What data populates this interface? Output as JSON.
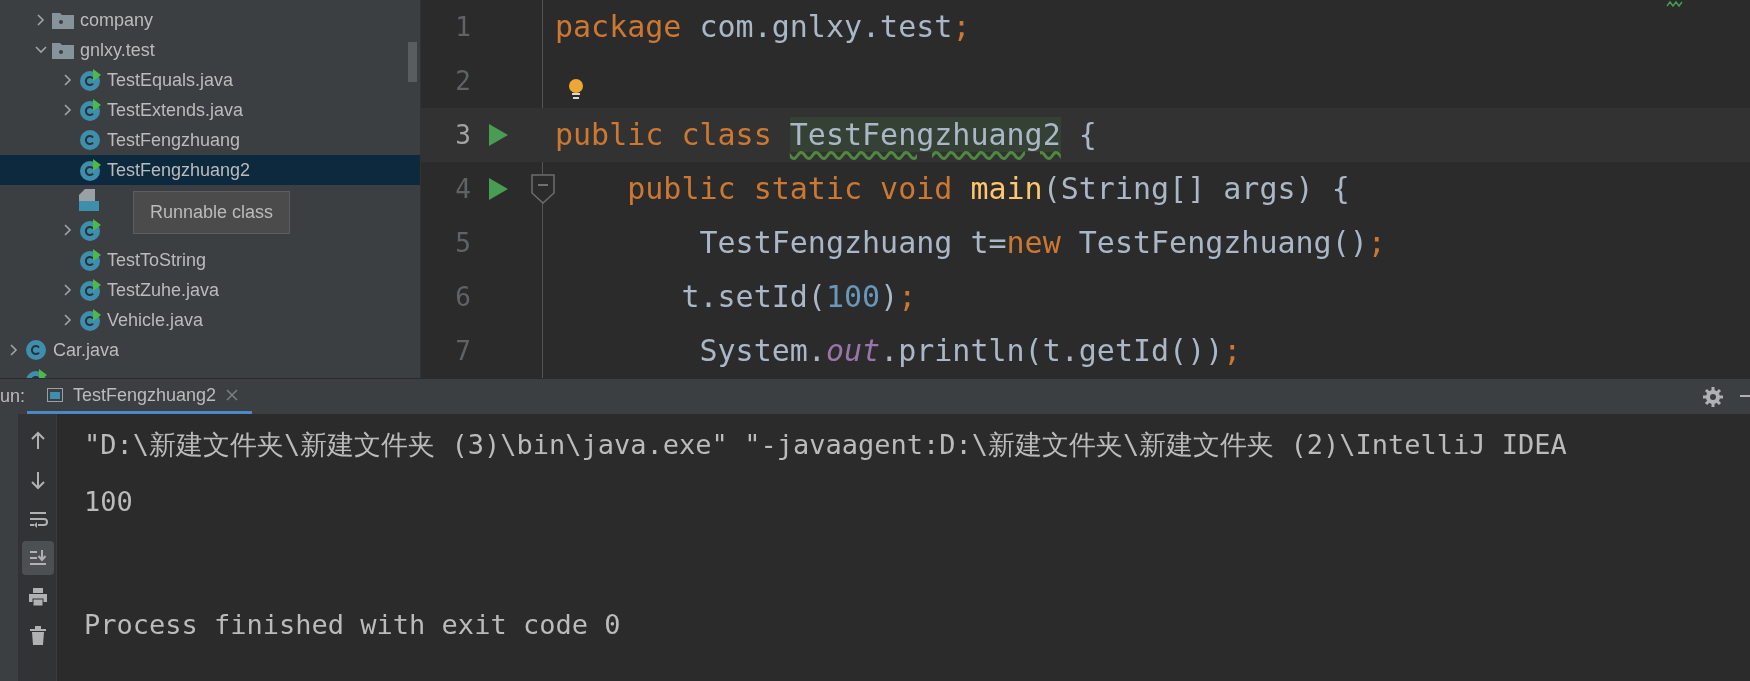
{
  "project_tree": {
    "items": [
      {
        "children": [
          {
            "label": "company",
            "kind": "folder",
            "expanded": false,
            "selected": false
          },
          {
            "label": "gnlxy.test",
            "kind": "folder",
            "expanded": true,
            "selected": false,
            "children": [
              {
                "label": "TestEquals.java",
                "kind": "runnable",
                "expanded": false,
                "selected": false
              },
              {
                "label": "TestExtends.java",
                "kind": "runnable",
                "expanded": false,
                "selected": false
              },
              {
                "label": "TestFengzhuang",
                "kind": "class",
                "selected": false
              },
              {
                "label": "TestFengzhuang2",
                "kind": "runnable",
                "selected": true
              },
              {
                "kind": "java-file",
                "selected": false
              },
              {
                "kind": "runnable",
                "expanded": false,
                "selected": false
              },
              {
                "label": "TestToString",
                "kind": "runnable",
                "selected": false
              },
              {
                "label": "TestZuhe.java",
                "kind": "runnable",
                "expanded": false,
                "selected": false
              },
              {
                "label": "Vehicle.java",
                "kind": "runnable",
                "expanded": false,
                "selected": false
              }
            ]
          }
        ]
      },
      {
        "label": "Car.java",
        "kind": "class",
        "expanded": false,
        "selected": false
      },
      {
        "kind": "runnable",
        "selected": false
      }
    ]
  },
  "tooltip": {
    "text": "Runnable class"
  },
  "editor": {
    "lines": [
      {
        "number": "1",
        "current": false,
        "run_marker": false,
        "fold_marker": false,
        "tokens": [
          {
            "text": "package",
            "kind": "keyword"
          },
          {
            "text": " com.gnlxy.test",
            "kind": "plain"
          },
          {
            "text": ";",
            "kind": "keyword"
          }
        ]
      },
      {
        "number": "2",
        "current": false,
        "run_marker": false,
        "fold_marker": false
      },
      {
        "number": "3",
        "current": true,
        "run_marker": true,
        "fold_marker": false,
        "tokens": [
          {
            "text": "public class ",
            "kind": "keyword"
          },
          {
            "text": "TestFengzhuang2",
            "kind": "highlight"
          },
          {
            "text": " {",
            "kind": "plain"
          }
        ]
      },
      {
        "number": "4",
        "current": false,
        "run_marker": true,
        "fold_marker": true,
        "tokens": [
          {
            "text": "    public static void ",
            "kind": "keyword"
          },
          {
            "text": "main",
            "kind": "method"
          },
          {
            "text": "(String[] args) {",
            "kind": "plain"
          }
        ]
      },
      {
        "number": "5",
        "current": false,
        "run_marker": false,
        "fold_marker": false,
        "tokens": [
          {
            "text": "        TestFengzhuang t=",
            "kind": "plain"
          },
          {
            "text": "new",
            "kind": "keyword"
          },
          {
            "text": " TestFengzhuang()",
            "kind": "plain"
          },
          {
            "text": ";",
            "kind": "keyword"
          }
        ]
      },
      {
        "number": "6",
        "current": false,
        "run_marker": false,
        "fold_marker": false,
        "tokens": [
          {
            "text": "       t.setId(",
            "kind": "plain"
          },
          {
            "text": "100",
            "kind": "number"
          },
          {
            "text": ")",
            "kind": "plain"
          },
          {
            "text": ";",
            "kind": "keyword"
          }
        ]
      },
      {
        "number": "7",
        "current": false,
        "run_marker": false,
        "fold_marker": false,
        "tokens": [
          {
            "text": "        System.",
            "kind": "plain"
          },
          {
            "text": "out",
            "kind": "field"
          },
          {
            "text": ".println(t.getId())",
            "kind": "plain"
          },
          {
            "text": ";",
            "kind": "keyword"
          }
        ]
      }
    ]
  },
  "run_panel": {
    "label": "un:",
    "tabs": [
      {
        "label": "TestFengzhuang2",
        "selected": true
      }
    ],
    "toolbar": [
      {
        "kind": "up",
        "active": false
      },
      {
        "kind": "down",
        "active": false
      },
      {
        "kind": "wrap",
        "active": false
      },
      {
        "kind": "scroll-end",
        "active": true
      },
      {
        "kind": "print",
        "active": false
      },
      {
        "kind": "trash",
        "active": false
      }
    ],
    "console": [
      "\"D:\\新建文件夹\\新建文件夹 (3)\\bin\\java.exe\" \"-javaagent:D:\\新建文件夹\\新建文件夹 (2)\\IntelliJ IDEA",
      "100",
      "Process finished with exit code 0"
    ]
  }
}
